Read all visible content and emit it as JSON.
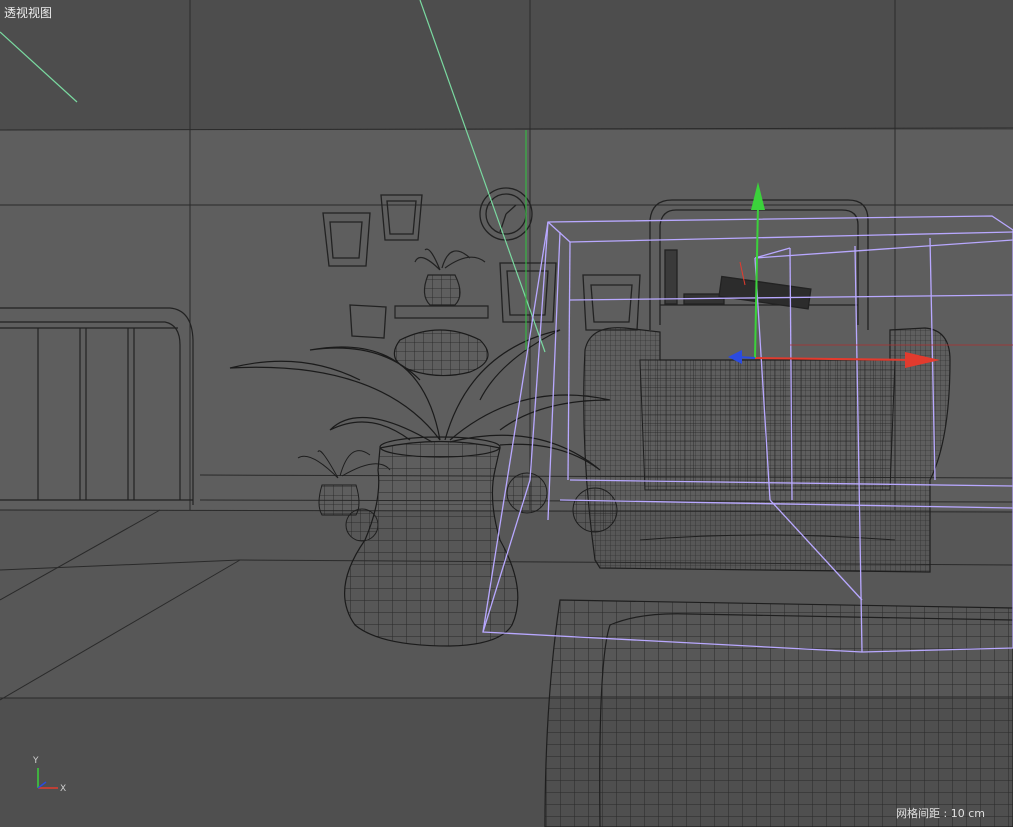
{
  "viewport": {
    "title": "透视视图",
    "grid_spacing": "网格间距 : 10 cm"
  },
  "axis_indicator": {
    "y_label": "Y",
    "x_label": "X"
  },
  "colors": {
    "background": "#5a5a5a",
    "ceiling": "#4d4d4d",
    "wall": "#5e5e5e",
    "floor": "#555555",
    "wire": "#1e1e1e",
    "selection_box": "#b8a8ff",
    "gizmo_x": "#e23b2e",
    "gizmo_y": "#3bd23b",
    "gizmo_z": "#2b4be0",
    "guide_line": "#7ad9a0"
  }
}
